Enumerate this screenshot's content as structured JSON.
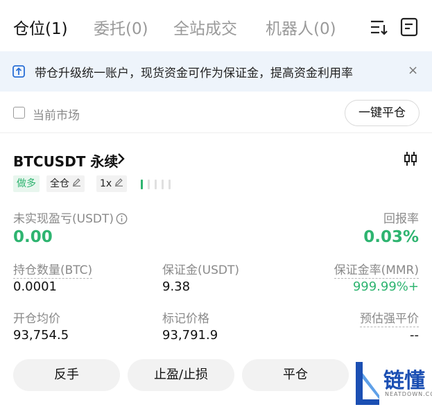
{
  "tabs": [
    {
      "label": "仓位(1)",
      "active": true
    },
    {
      "label": "委托(0)",
      "active": false
    },
    {
      "label": "全站成交",
      "active": false
    },
    {
      "label": "机器人(0)",
      "active": false
    }
  ],
  "tab_icons": [
    "sort-list-icon",
    "document-icon"
  ],
  "banner": {
    "text": "带仓升级统一账户，现货资金可作为保证金，提高资金利用率",
    "close": "×",
    "icon": "upgrade-icon"
  },
  "filter": {
    "checkbox_label": "当前市场",
    "checked": false,
    "close_all_label": "一键平仓"
  },
  "position": {
    "symbol": "BTCUSDT 永续",
    "side": "做多",
    "margin_mode": "全仓",
    "leverage": "1x",
    "adl_level": 1,
    "adl_total": 5,
    "unrealized_pnl_label": "未实现盈亏(USDT)",
    "unrealized_pnl": "0.00",
    "roe_label": "回报率",
    "roe": "0.03%",
    "size_label": "持仓数量(BTC)",
    "size": "0.0001",
    "margin_label": "保证金(USDT)",
    "margin": "9.38",
    "mmr_label": "保证金率(MMR)",
    "mmr": "999.99%+",
    "entry_label": "开仓均价",
    "entry": "93,754.5",
    "mark_label": "标记价格",
    "mark": "93,791.9",
    "liq_label": "预估强平价",
    "liq": "--"
  },
  "actions": {
    "reverse": "反手",
    "tpsl": "止盈/止损",
    "close": "平仓"
  },
  "watermark": {
    "text": "链懂",
    "sub": "NEATDOWN.COM"
  },
  "colors": {
    "green": "#2eb470",
    "banner_bg": "#eef4fb",
    "button_bg": "#f2f2f2",
    "brand": "#1b4fb3"
  }
}
